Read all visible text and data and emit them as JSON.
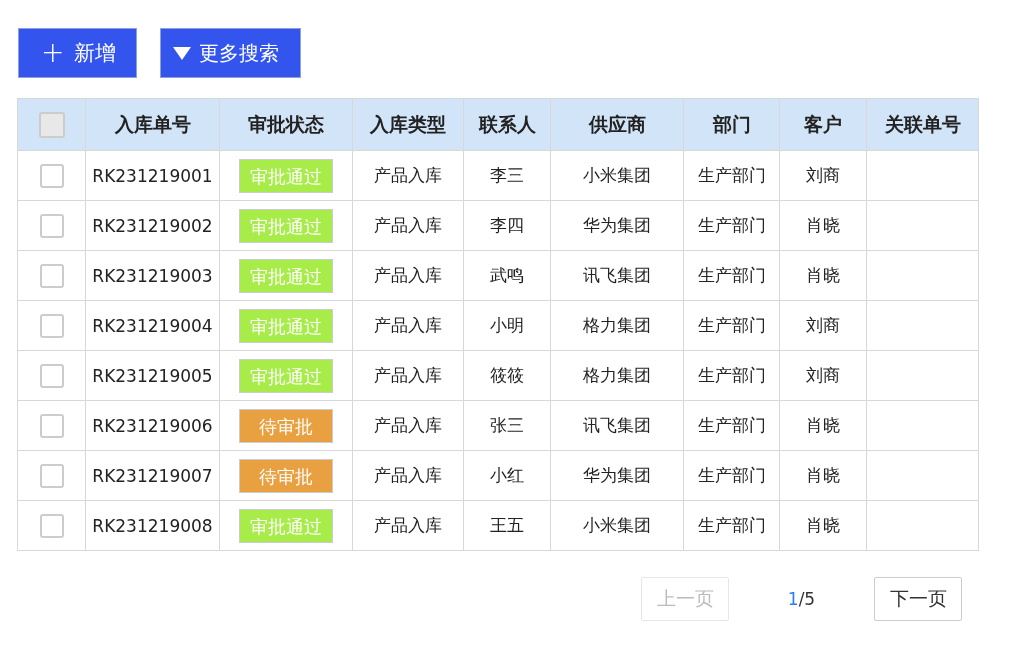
{
  "toolbar": {
    "add_button": {
      "icon": "+",
      "label": "新增"
    },
    "more_search_button": {
      "label": "更多搜索"
    }
  },
  "table": {
    "header_checked": false,
    "columns": [
      "入库单号",
      "审批状态",
      "入库类型",
      "联系人",
      "供应商",
      "部门",
      "客户",
      "关联单号"
    ],
    "rows": [
      {
        "checked": false,
        "number": "RK231219001",
        "status": {
          "kind": "approved",
          "label": "审批通过"
        },
        "type": "产品入库",
        "contact": "李三",
        "supplier": "小米集团",
        "department": "生产部门",
        "customer": "刘商"
      },
      {
        "checked": false,
        "number": "RK231219002",
        "status": {
          "kind": "approved",
          "label": "审批通过"
        },
        "type": "产品入库",
        "contact": "李四",
        "supplier": "华为集团",
        "department": "生产部门",
        "customer": "肖晓"
      },
      {
        "checked": false,
        "number": "RK231219003",
        "status": {
          "kind": "approved",
          "label": "审批通过"
        },
        "type": "产品入库",
        "contact": "武鸣",
        "supplier": "讯飞集团",
        "department": "生产部门",
        "customer": "肖晓"
      },
      {
        "checked": false,
        "number": "RK231219004",
        "status": {
          "kind": "approved",
          "label": "审批通过"
        },
        "type": "产品入库",
        "contact": "小明",
        "supplier": "格力集团",
        "department": "生产部门",
        "customer": "刘商"
      },
      {
        "checked": false,
        "number": "RK231219005",
        "status": {
          "kind": "approved",
          "label": "审批通过"
        },
        "type": "产品入库",
        "contact": "筱筱",
        "supplier": "格力集团",
        "department": "生产部门",
        "customer": "刘商"
      },
      {
        "checked": false,
        "number": "RK231219006",
        "status": {
          "kind": "pending",
          "label": "待审批"
        },
        "type": "产品入库",
        "contact": "张三",
        "supplier": "讯飞集团",
        "department": "生产部门",
        "customer": "肖晓"
      },
      {
        "checked": false,
        "number": "RK231219007",
        "status": {
          "kind": "pending",
          "label": "待审批"
        },
        "type": "产品入库",
        "contact": "小红",
        "supplier": "华为集团",
        "department": "生产部门",
        "customer": "肖晓"
      },
      {
        "checked": false,
        "number": "RK231219008",
        "status": {
          "kind": "approved",
          "label": "审批通过"
        },
        "type": "产品入库",
        "contact": "王五",
        "supplier": "小米集团",
        "department": "生产部门",
        "customer": "肖晓"
      }
    ]
  },
  "pagination": {
    "prev": {
      "label": "上一页",
      "disabled": true
    },
    "current": "1",
    "total": "/5",
    "next": {
      "label": "下一页",
      "disabled": false
    }
  }
}
